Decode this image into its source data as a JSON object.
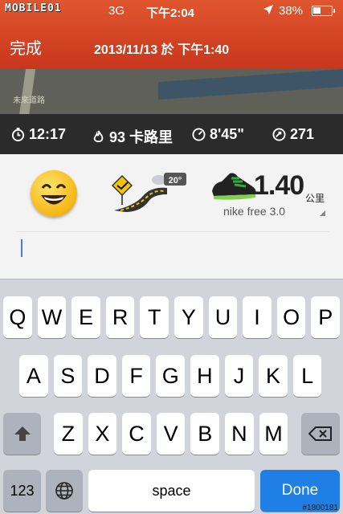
{
  "status_bar": {
    "brand": "MOBILE01",
    "carrier": "3G",
    "time": "下午2:04",
    "battery": "38%",
    "battery_level": 0.38
  },
  "nav": {
    "done_label": "完成",
    "title": "2013/11/13 於 下午1:40"
  },
  "map": {
    "label": "未來道路"
  },
  "stats": {
    "duration": "12:17",
    "calories": "93 卡路里",
    "pace": "8'45\"",
    "fuel": "271"
  },
  "summary": {
    "feeling": "smiley-happy",
    "temperature": "20°",
    "distance": "1.40",
    "unit": "公里",
    "shoe": "nike free 3.0"
  },
  "keyboard": {
    "row1": [
      "Q",
      "W",
      "E",
      "R",
      "T",
      "Y",
      "U",
      "I",
      "O",
      "P"
    ],
    "row2": [
      "A",
      "S",
      "D",
      "F",
      "G",
      "H",
      "J",
      "K",
      "L"
    ],
    "row3": [
      "Z",
      "X",
      "C",
      "V",
      "B",
      "N",
      "M"
    ],
    "num_label": "123",
    "space_label": "space",
    "done_label": "Done"
  },
  "watermark": "#1800181",
  "colors": {
    "accent": "#d2431f",
    "done_key": "#1f7fe5"
  }
}
